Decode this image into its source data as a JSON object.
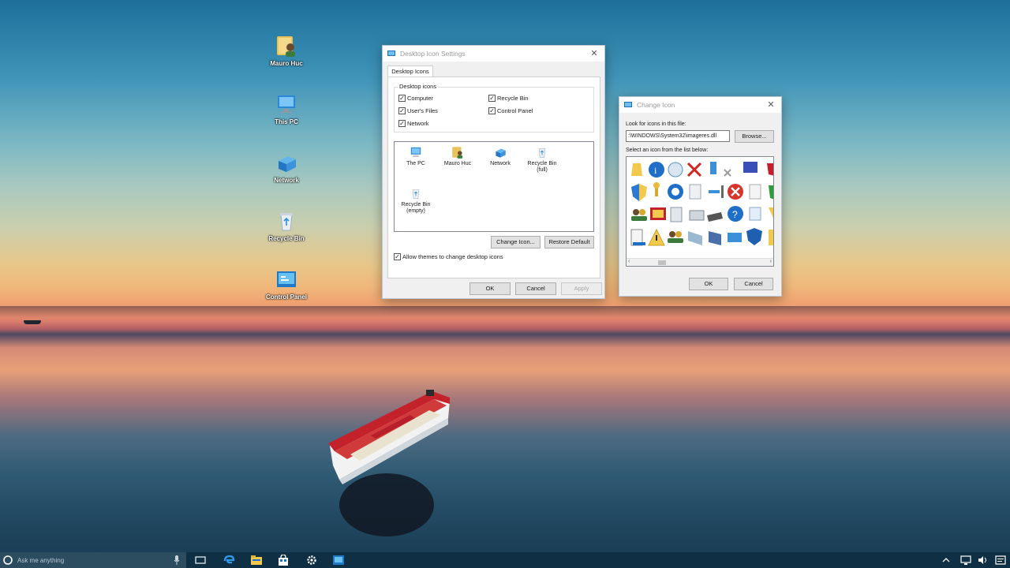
{
  "desktop": {
    "icons": [
      {
        "name": "user-files",
        "label": "Mauro Huc"
      },
      {
        "name": "this-pc",
        "label": "This PC"
      },
      {
        "name": "network",
        "label": "Network"
      },
      {
        "name": "recycle-bin",
        "label": "Recycle Bin"
      },
      {
        "name": "control-panel",
        "label": "Control Panel"
      }
    ]
  },
  "dialog_settings": {
    "title": "Desktop Icon Settings",
    "tab": "Desktop Icons",
    "group_label": "Desktop icons",
    "checkboxes": [
      {
        "label": "Computer",
        "checked": true
      },
      {
        "label": "Recycle Bin",
        "checked": true
      },
      {
        "label": "User's Files",
        "checked": true
      },
      {
        "label": "Control Panel",
        "checked": true
      },
      {
        "label": "Network",
        "checked": true
      }
    ],
    "icons": [
      {
        "label": "The PC"
      },
      {
        "label": "Mauro Huc"
      },
      {
        "label": "Network"
      },
      {
        "label": "Recycle Bin (full)"
      },
      {
        "label": "Recycle Bin (empty)"
      }
    ],
    "change_icon_btn": "Change Icon...",
    "restore_default_btn": "Restore Default",
    "allow_themes_label": "Allow themes to change desktop icons",
    "ok_btn": "OK",
    "cancel_btn": "Cancel",
    "apply_btn": "Apply"
  },
  "dialog_change_icon": {
    "title": "Change Icon",
    "look_label": "Look for icons in this file:",
    "file_path": "%SystemRoot%\\System32\\imageres.dll",
    "file_path_display": ":\\WINDOWS\\System32\\imageres.dll",
    "browse_btn": "Browse...",
    "select_label": "Select an icon from the list below:",
    "ok_btn": "OK",
    "cancel_btn": "Cancel"
  },
  "taskbar": {
    "search_placeholder": "Ask me anything"
  },
  "colors": {
    "taskbar": "#0f3044",
    "accent": "#1e90d6",
    "dialog_bg": "#f0f0f0"
  }
}
